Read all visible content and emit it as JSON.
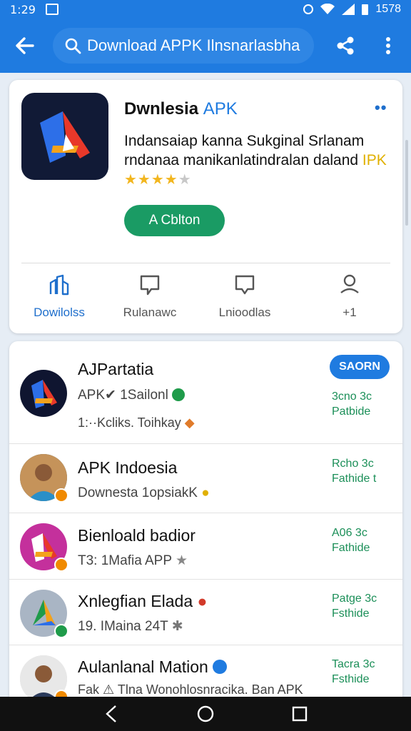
{
  "status_bar": {
    "time": "1:29",
    "battery": "1578"
  },
  "toolbar": {
    "search_text": "Download APPK Ilnsnarlasbha"
  },
  "app": {
    "name": "Dwnlesia",
    "name_accent": "APK",
    "desc_line1": "Indansaiap kanna Sukginal Srlanam",
    "desc_line2": "rndanaa manikanlatindralan daland",
    "desc_accent": "IPK",
    "stars": "★★★★",
    "stars_off": "★",
    "install_label": "A Cblton",
    "menu_dots": "••"
  },
  "tabs": [
    {
      "label": "Dowilolss"
    },
    {
      "label": "Rulanawc"
    },
    {
      "label": "Lnioodlas"
    },
    {
      "label": "+1"
    }
  ],
  "list": [
    {
      "title": "AJPartatia",
      "sub": "APK✔ 1Sailonl",
      "sub2": "1:··Kcliks. Toihkay",
      "side1": "",
      "side2": "",
      "button": "SAORN",
      "side_btn1": "3cno 3c",
      "side_btn2": "Patbide"
    },
    {
      "title": "APK Indoesia",
      "sub": "Downesta 1opsiakK",
      "side1": "Rcho 3c",
      "side2": "Fathide t"
    },
    {
      "title": "Bienloald badior",
      "sub": "T3: 1Mafia APP",
      "side1": "A06 3c",
      "side2": "Fathide"
    },
    {
      "title": "Xnlegfian Elada",
      "sub": "19. IMaina 24T",
      "side1": "Patge 3c",
      "side2": "Fsthide"
    },
    {
      "title": "Aulanlanal Mation",
      "sub": "Fak ⚠ Tlna Wonohlosnracika. Ban APK",
      "side1": "Tacra 3c",
      "side2": "Fsthide"
    }
  ],
  "colors": {
    "primary": "#1f7be0",
    "green": "#1a9b64",
    "star": "#f2b61f"
  }
}
